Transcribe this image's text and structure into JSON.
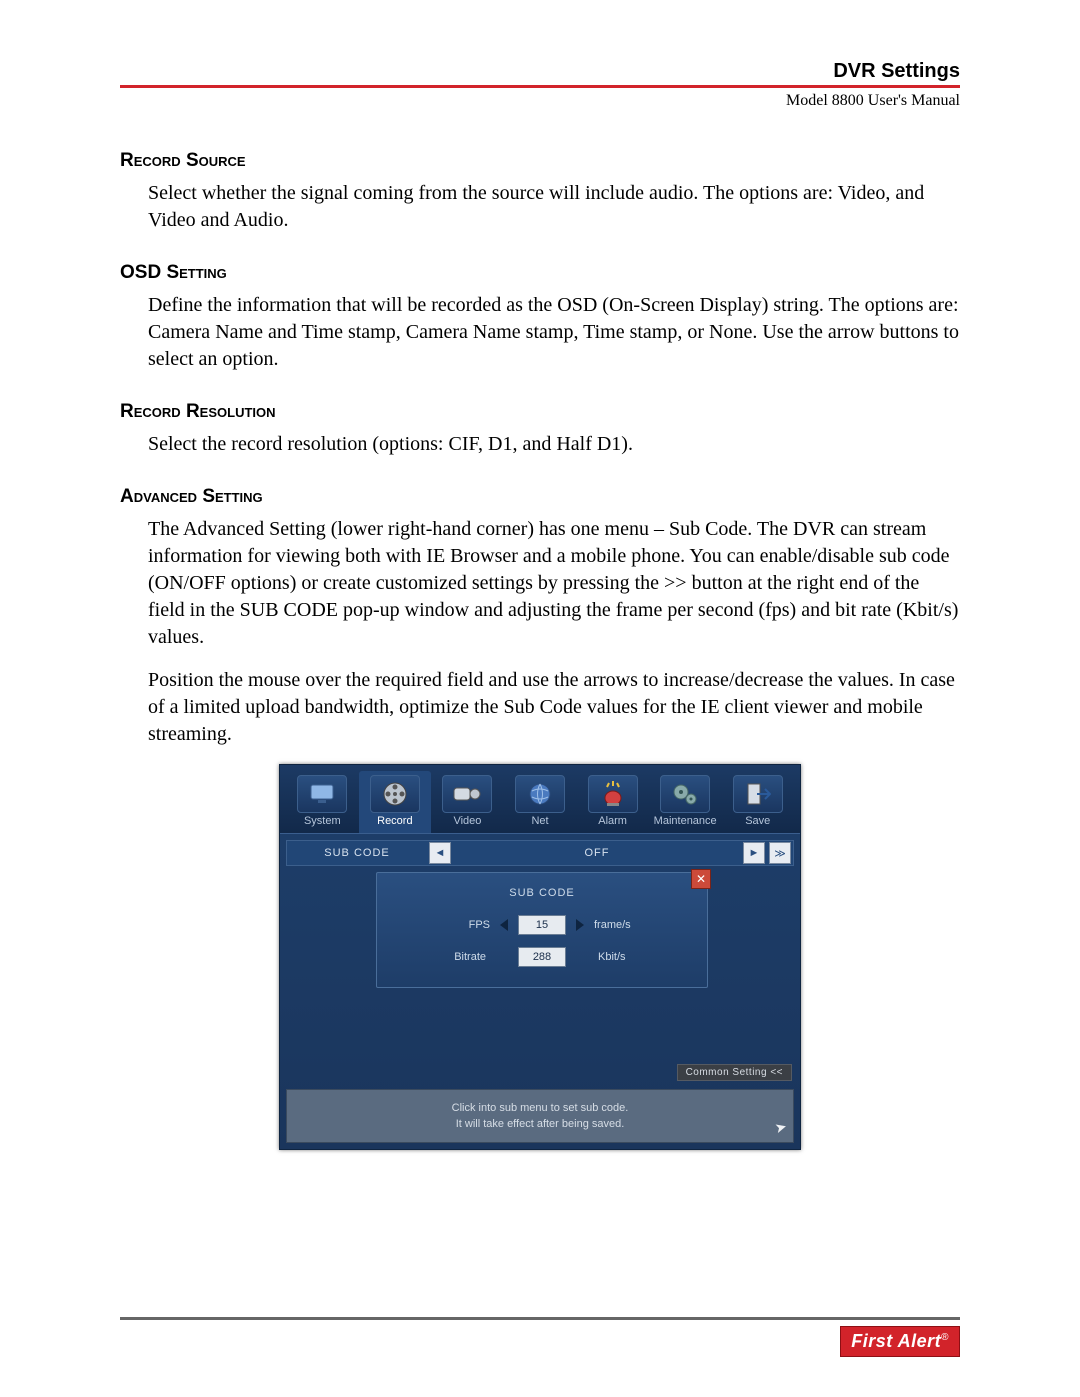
{
  "header": {
    "title": "DVR Settings",
    "subtitle": "Model 8800 User's Manual"
  },
  "sections": {
    "record_source": {
      "heading": "Record Source",
      "body": "Select whether the signal coming from the source will include audio. The options are: Video, and Video and Audio."
    },
    "osd_setting": {
      "heading": "OSD Setting",
      "body": "Define the information that will be recorded as the OSD (On-Screen Display) string. The options are: Camera Name and Time stamp, Camera Name stamp, Time stamp, or None. Use the arrow buttons to select an option."
    },
    "record_resolution": {
      "heading": "Record Resolution",
      "body": "Select the record resolution (options: CIF, D1, and Half D1)."
    },
    "advanced_setting": {
      "heading": "Advanced Setting",
      "body1": "The Advanced Setting (lower right-hand corner) has one menu – Sub Code. The DVR can stream information for viewing both with IE Browser and a mobile phone. You can enable/disable sub code (ON/OFF options) or create customized settings by pressing the >> button at the right end of the field in the SUB CODE pop-up window and adjusting the frame per second (fps) and bit rate (Kbit/s) values.",
      "body2": "Position the mouse over the required field and use the arrows to increase/decrease the values. In case of a limited upload bandwidth, optimize the Sub Code values for the IE client viewer and mobile streaming."
    }
  },
  "dvr_ui": {
    "tabs": [
      "System",
      "Record",
      "Video",
      "Net",
      "Alarm",
      "Maintenance",
      "Save"
    ],
    "active_tab_index": 1,
    "subcode_label": "SUB CODE",
    "subcode_value": "OFF",
    "arrow_left": "◄",
    "arrow_right": "►",
    "arrow_expand": "≫",
    "popup": {
      "title": "SUB CODE",
      "close": "✕",
      "fps_label": "FPS",
      "fps_value": "15",
      "fps_unit": "frame/s",
      "bitrate_label": "Bitrate",
      "bitrate_value": "288",
      "bitrate_unit": "Kbit/s"
    },
    "common_setting": "Common Setting <<",
    "hint1": "Click into sub menu to set sub code.",
    "hint2": "It will take effect after being saved.",
    "cursor": "↖"
  },
  "footer": {
    "brand": "First Alert",
    "reg": "®"
  }
}
